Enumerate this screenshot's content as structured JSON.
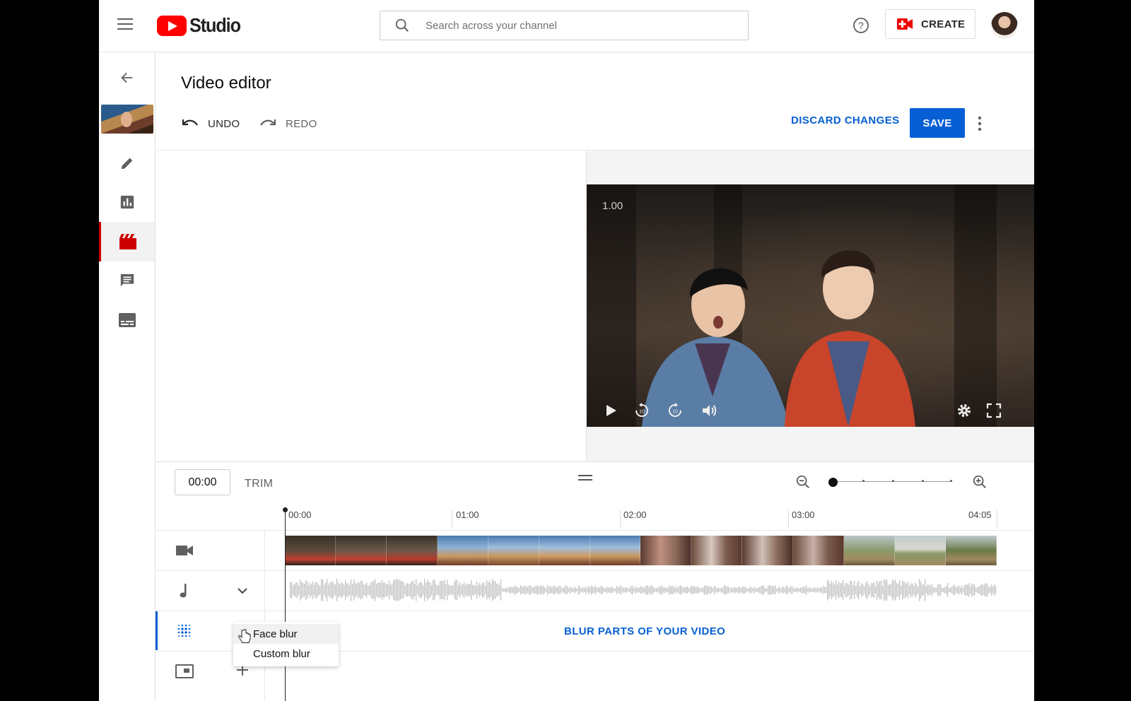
{
  "header": {
    "logo_text": "Studio",
    "search_placeholder": "Search across your channel",
    "create_label": "CREATE"
  },
  "editor": {
    "title": "Video editor",
    "undo_label": "UNDO",
    "redo_label": "REDO",
    "discard_label": "DISCARD CHANGES",
    "save_label": "SAVE"
  },
  "player": {
    "speed_label": "1.00"
  },
  "timeline": {
    "current_time": "00:00",
    "trim_label": "TRIM",
    "ruler": [
      "00:00",
      "01:00",
      "02:00",
      "03:00",
      "04:05"
    ],
    "blur_cta": "BLUR PARTS OF YOUR VIDEO"
  },
  "blur_menu": {
    "items": [
      "Face blur",
      "Custom blur"
    ]
  },
  "colors": {
    "accent_blue": "#065fd4",
    "brand_red": "#ff0000"
  },
  "icons": {
    "nav": [
      "back-arrow-icon",
      "pencil-icon",
      "analytics-icon",
      "editor-clapper-icon",
      "comments-icon",
      "subtitles-icon"
    ],
    "tracks": [
      "video-camera-icon",
      "music-note-icon",
      "blur-icon",
      "end-screen-icon"
    ]
  }
}
